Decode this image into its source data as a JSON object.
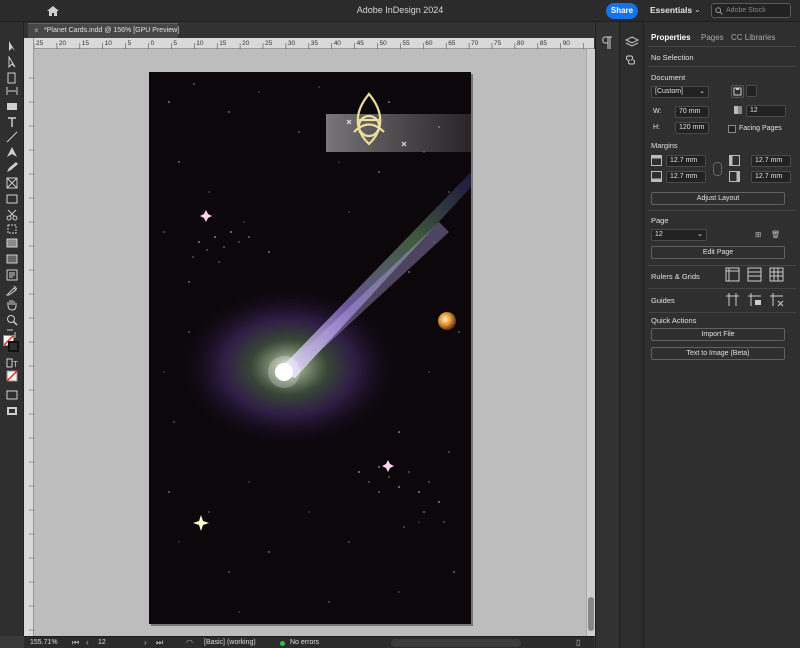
{
  "app": {
    "title": "Adobe InDesign 2024"
  },
  "header": {
    "share_label": "Share",
    "workspace_label": "Essentials",
    "stock_placeholder": "Adobe Stock"
  },
  "document_tab": {
    "close_glyph": "×",
    "title": "*Planet Cards.indd @ 156% [GPU Preview]"
  },
  "ruler": {
    "h_ticks": [
      "25",
      "20",
      "15",
      "10",
      "5",
      "0",
      "5",
      "10",
      "15",
      "20",
      "25",
      "30",
      "35",
      "40",
      "45",
      "50",
      "55",
      "60",
      "65",
      "70",
      "75",
      "80",
      "85",
      "90"
    ]
  },
  "status": {
    "zoom": "155.71%",
    "page": "12",
    "style": "[Basic] (working)",
    "errors": "No errors"
  },
  "panel": {
    "tabs": [
      "Properties",
      "Pages",
      "CC Libraries"
    ],
    "selection": "No Selection",
    "document_heading": "Document",
    "preset": "[Custom]",
    "pages_count": "12",
    "width_label": "W:",
    "width": "70 mm",
    "height_label": "H:",
    "height": "120 mm",
    "facing_pages": "Facing Pages",
    "margins_heading": "Margins",
    "margin_top": "12.7 mm",
    "margin_bottom": "12.7 mm",
    "margin_left": "12.7 mm",
    "margin_right": "12.7 mm",
    "adjust_layout": "Adjust Layout",
    "page_heading": "Page",
    "page_value": "12",
    "edit_page": "Edit Page",
    "rulers_grids": "Rulers & Grids",
    "guides": "Guides",
    "quick_actions": "Quick Actions",
    "import_file": "Import File",
    "text_to_image": "Text to Image (Beta)"
  },
  "colors": {
    "accent": "#1473e6",
    "page_bg": "#0c070b",
    "pasteboard": "#bdbdbd"
  }
}
